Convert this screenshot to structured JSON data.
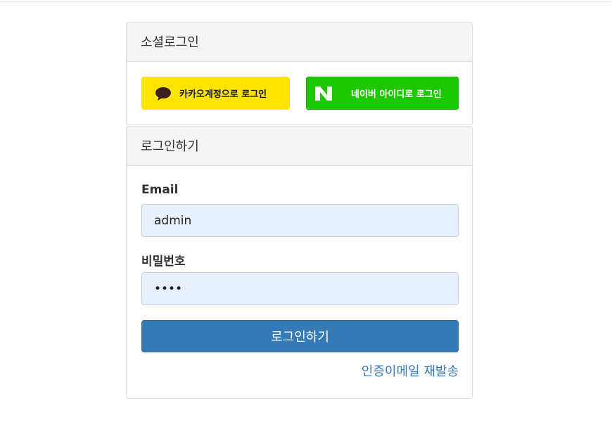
{
  "social_panel": {
    "title": "소셜로그인",
    "kakao_label": "카카오계정으로 로그인",
    "naver_label": "네이버 아이디로 로그인"
  },
  "login_panel": {
    "title": "로그인하기",
    "email_label": "Email",
    "email_value": "admin",
    "password_label": "비밀번호",
    "password_value": "••••",
    "submit_label": "로그인하기",
    "resend_link": "인증이메일 재발송"
  },
  "colors": {
    "kakao_yellow": "#fee500",
    "naver_green": "#1ec800",
    "primary_blue": "#337ab7",
    "autofill_bg": "#e8f0fe"
  },
  "icons": {
    "kakao": "speech-bubble-icon",
    "naver": "naver-n-logo"
  }
}
